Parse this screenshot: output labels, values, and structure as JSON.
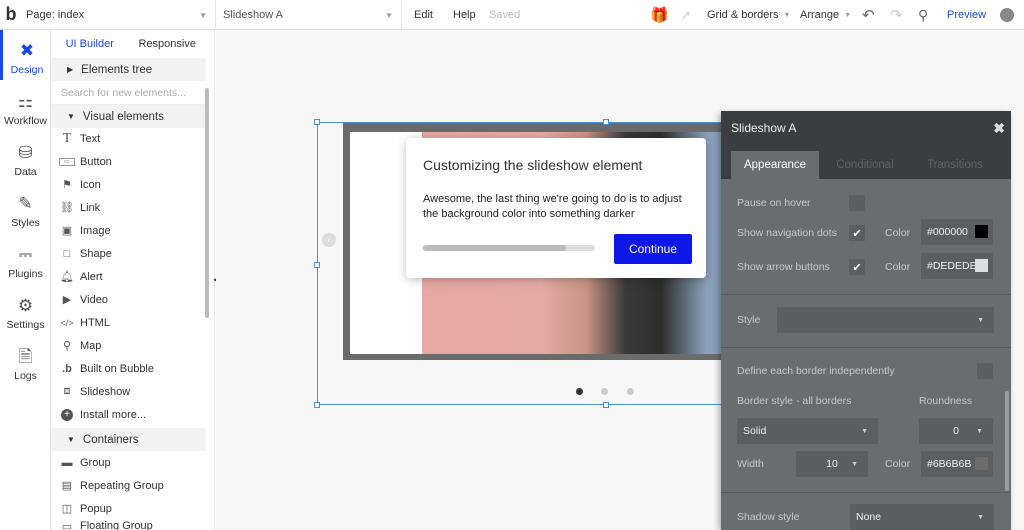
{
  "topbar": {
    "logo": "b",
    "page_label": "Page: index",
    "element_label": "Slideshow A",
    "edit": "Edit",
    "help": "Help",
    "saved": "Saved",
    "grid": "Grid & borders",
    "arrange": "Arrange",
    "preview": "Preview"
  },
  "rail": {
    "items": [
      {
        "label": "Design",
        "icon": "design-icon"
      },
      {
        "label": "Workflow",
        "icon": "workflow-icon"
      },
      {
        "label": "Data",
        "icon": "data-icon"
      },
      {
        "label": "Styles",
        "icon": "styles-icon"
      },
      {
        "label": "Plugins",
        "icon": "plugins-icon"
      },
      {
        "label": "Settings",
        "icon": "settings-icon"
      },
      {
        "label": "Logs",
        "icon": "logs-icon"
      }
    ]
  },
  "panel": {
    "tab_builder": "UI Builder",
    "tab_responsive": "Responsive",
    "elements_tree": "Elements tree",
    "search_placeholder": "Search for new elements...",
    "visual_elements": "Visual elements",
    "items": [
      "Text",
      "Button",
      "Icon",
      "Link",
      "Image",
      "Shape",
      "Alert",
      "Video",
      "HTML",
      "Map",
      "Built on Bubble",
      "Slideshow",
      "Install more..."
    ],
    "containers": "Containers",
    "container_items": [
      "Group",
      "Repeating Group",
      "Popup",
      "Floating Group"
    ]
  },
  "tip": {
    "title": "Customizing the slideshow element",
    "body": "Awesome, the last thing we're going to do is to adjust the background color into something darker",
    "button": "Continue",
    "progress": 0.83
  },
  "prop": {
    "title": "Slideshow A",
    "tabs": [
      "Appearance",
      "Conditional",
      "Transitions"
    ],
    "pause_on_hover": "Pause on hover",
    "show_nav_dots": "Show navigation dots",
    "show_arrows": "Show arrow buttons",
    "color_label": "Color",
    "nav_color": "#000000",
    "arrow_color": "#DEDEDE",
    "style_label": "Style",
    "define_border": "Define each border independently",
    "border_style_label": "Border style - all borders",
    "roundness_label": "Roundness",
    "border_style_value": "Solid",
    "roundness_value": "0",
    "width_label": "Width",
    "width_value": "10",
    "border_color": "#6B6B6B",
    "shadow_label": "Shadow style",
    "shadow_value": "None"
  },
  "colors": {
    "accent": "#1b48e8",
    "continue_button": "#0d18e6",
    "nav_swatch": "#000000",
    "arrow_swatch": "#DEDEDE",
    "border_swatch": "#6B6B6B"
  }
}
